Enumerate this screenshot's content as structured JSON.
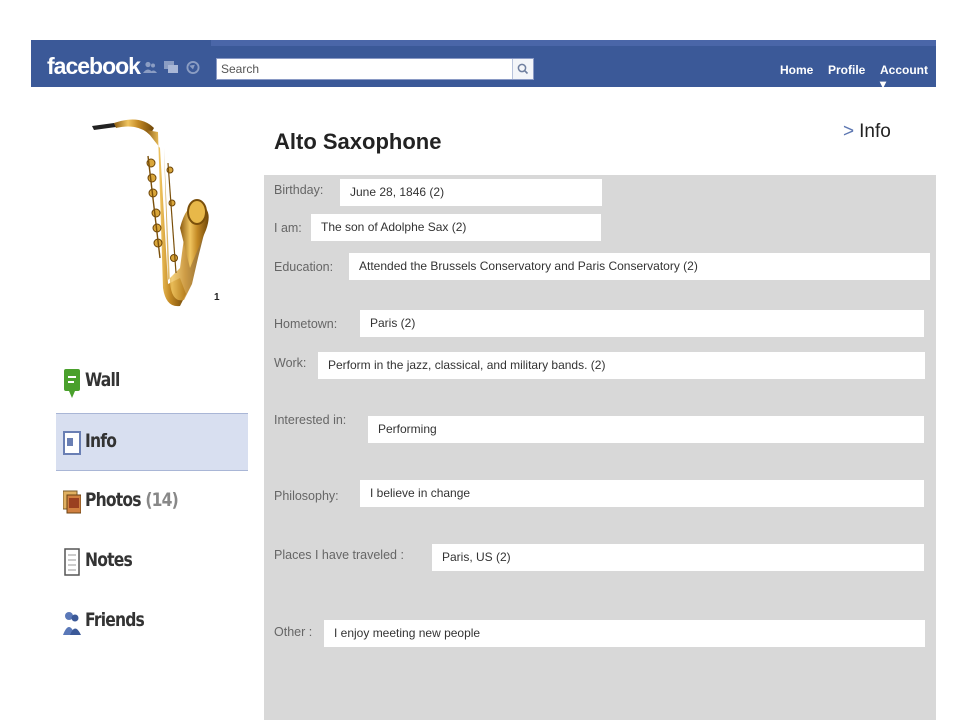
{
  "header": {
    "logo": "facebook",
    "search_placeholder": "Search",
    "nav": {
      "home": "Home",
      "profile": "Profile",
      "account": "Account ▾"
    }
  },
  "profile": {
    "name": "Alto Saxophone",
    "breadcrumb_sep": ">",
    "breadcrumb": "Info",
    "image_caption": "1"
  },
  "sidebar": {
    "items": [
      {
        "label": "Wall",
        "icon": "wall-icon"
      },
      {
        "label": "Info",
        "icon": "info-icon",
        "active": true
      },
      {
        "label": "Photos",
        "count": "(14)",
        "icon": "photos-icon"
      },
      {
        "label": "Notes",
        "icon": "notes-icon"
      },
      {
        "label": "Friends",
        "icon": "friends-icon"
      }
    ]
  },
  "info": {
    "birthday": {
      "label": "Birthday:",
      "value": "June 28, 1846  (2)"
    },
    "i_am": {
      "label": "I am:",
      "value": "The son of Adolphe Sax (2)"
    },
    "education": {
      "label": "Education:",
      "value": "Attended the Brussels Conservatory and Paris Conservatory (2)"
    },
    "hometown": {
      "label": "Hometown:",
      "value": "Paris (2)"
    },
    "work": {
      "label": "Work:",
      "value": "Perform in the jazz, classical, and military bands. (2)"
    },
    "interested_in": {
      "label": "Interested in:",
      "value": "Performing"
    },
    "philosophy": {
      "label": "Philosophy:",
      "value": "I believe in change"
    },
    "places": {
      "label": "Places I have  traveled :",
      "value": "Paris, US (2)"
    },
    "other": {
      "label": "Other :",
      "value": "I enjoy meeting new people"
    }
  },
  "colors": {
    "brand": "#3b5998",
    "panel": "#d8d8d8",
    "active_tab": "#d8dff0"
  }
}
